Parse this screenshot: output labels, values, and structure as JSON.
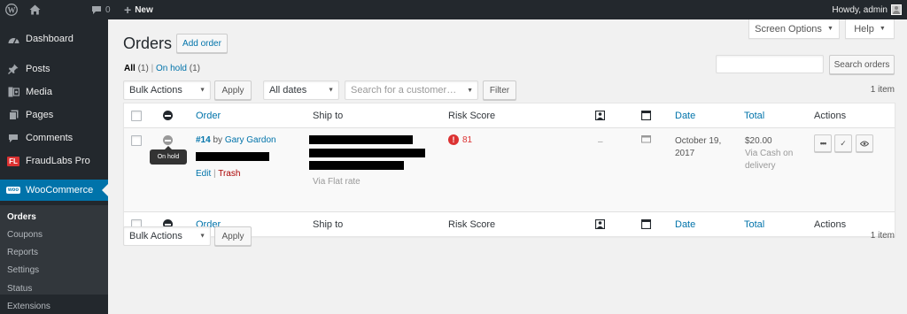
{
  "admin_bar": {
    "wp_icon": "wordpress-icon",
    "home_icon": "home-icon",
    "comments_icon": "comment-bubble-icon",
    "comments_count": "0",
    "new_label": "New",
    "howdy": "Howdy, admin"
  },
  "menu": {
    "items": [
      {
        "label": "Dashboard",
        "icon": "dashboard-icon"
      },
      {
        "label": "Posts",
        "icon": "pin-icon"
      },
      {
        "label": "Media",
        "icon": "media-icon"
      },
      {
        "label": "Pages",
        "icon": "pages-icon"
      },
      {
        "label": "Comments",
        "icon": "comments-icon"
      },
      {
        "label": "FraudLabs Pro",
        "icon": "fraudlabs-icon",
        "icon_text": "FL"
      },
      {
        "label": "WooCommerce",
        "icon": "woo-icon",
        "icon_text": "woo"
      }
    ],
    "submenu": [
      "Orders",
      "Coupons",
      "Reports",
      "Settings",
      "Status",
      "Extensions"
    ]
  },
  "header": {
    "screen_options": "Screen Options",
    "help": "Help",
    "title": "Orders",
    "add_order": "Add order"
  },
  "filters": {
    "all_label": "All",
    "all_count": "(1)",
    "separator": "|",
    "onhold_label": "On hold",
    "onhold_count": "(1)"
  },
  "search": {
    "button": "Search orders"
  },
  "top_nav": {
    "bulk_actions": "Bulk Actions",
    "apply": "Apply",
    "dates": "All dates",
    "customer_placeholder": "Search for a customer…",
    "filter": "Filter",
    "items": "1 item"
  },
  "columns": {
    "order": "Order",
    "ship_to": "Ship to",
    "risk": "Risk Score",
    "date": "Date",
    "total": "Total",
    "actions": "Actions"
  },
  "order": {
    "number": "#14",
    "by": "by",
    "customer": "Gary Gardon",
    "status_tooltip": "On hold",
    "edit": "Edit",
    "trash": "Trash",
    "ship_via": "Via Flat rate",
    "risk_score": "81",
    "dash": "–",
    "date_line1": "October 19,",
    "date_line2": "2017",
    "total": "$20.00",
    "payment_line1": "Via Cash on",
    "payment_line2": "delivery"
  },
  "bottom_nav": {
    "bulk_actions": "Bulk Actions",
    "apply": "Apply",
    "items": "1 item"
  },
  "colors": {
    "accent": "#0073aa",
    "admin_bg": "#23282d",
    "risk_red": "#dc3232"
  }
}
